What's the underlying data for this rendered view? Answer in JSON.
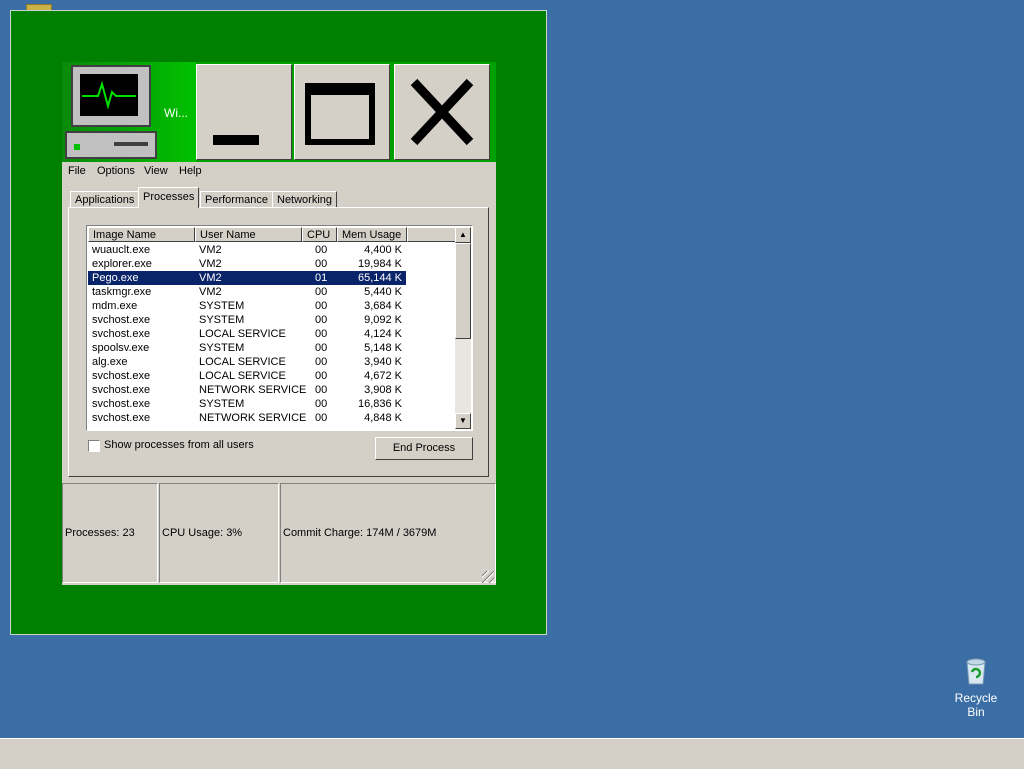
{
  "window": {
    "title": "Wi..."
  },
  "menu": [
    "File",
    "Options",
    "View",
    "Help"
  ],
  "tabs": [
    "Applications",
    "Processes",
    "Performance",
    "Networking"
  ],
  "active_tab": "Processes",
  "columns": [
    "Image Name",
    "User Name",
    "CPU",
    "Mem Usage"
  ],
  "processes": [
    {
      "name": "wuauclt.exe",
      "user": "VM2",
      "cpu": "00",
      "mem": "4,400 K"
    },
    {
      "name": "explorer.exe",
      "user": "VM2",
      "cpu": "00",
      "mem": "19,984 K"
    },
    {
      "name": "Pego.exe",
      "user": "VM2",
      "cpu": "01",
      "mem": "65,144 K",
      "selected": true
    },
    {
      "name": "taskmgr.exe",
      "user": "VM2",
      "cpu": "00",
      "mem": "5,440 K"
    },
    {
      "name": "mdm.exe",
      "user": "SYSTEM",
      "cpu": "00",
      "mem": "3,684 K"
    },
    {
      "name": "svchost.exe",
      "user": "SYSTEM",
      "cpu": "00",
      "mem": "9,092 K"
    },
    {
      "name": "svchost.exe",
      "user": "LOCAL SERVICE",
      "cpu": "00",
      "mem": "4,124 K"
    },
    {
      "name": "spoolsv.exe",
      "user": "SYSTEM",
      "cpu": "00",
      "mem": "5,148 K"
    },
    {
      "name": "alg.exe",
      "user": "LOCAL SERVICE",
      "cpu": "00",
      "mem": "3,940 K"
    },
    {
      "name": "svchost.exe",
      "user": "LOCAL SERVICE",
      "cpu": "00",
      "mem": "4,672 K"
    },
    {
      "name": "svchost.exe",
      "user": "NETWORK SERVICE",
      "cpu": "00",
      "mem": "3,908 K"
    },
    {
      "name": "svchost.exe",
      "user": "SYSTEM",
      "cpu": "00",
      "mem": "16,836 K"
    },
    {
      "name": "svchost.exe",
      "user": "NETWORK SERVICE",
      "cpu": "00",
      "mem": "4,848 K"
    }
  ],
  "show_all_label": "Show processes from all users",
  "end_process_label": "End Process",
  "status": {
    "processes": "Processes: 23",
    "cpu": "CPU Usage: 3%",
    "commit": "Commit Charge: 174M / 3679M"
  },
  "desktop": {
    "recycle_bin": "Recycle Bin"
  },
  "colors": {
    "desktop": "#3a6ea5",
    "outer_frame": "#008000",
    "selection": "#0a246a"
  }
}
